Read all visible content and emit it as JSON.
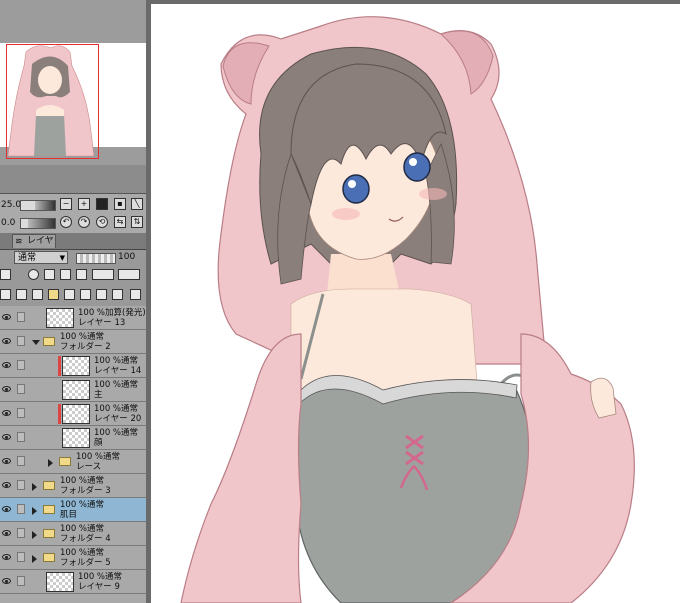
{
  "navigator": {
    "zoom_value": "25.0",
    "rotate_value": "0.0"
  },
  "layer_panel": {
    "tab_label": "レイヤー",
    "blend_mode": "通常",
    "opacity": "100"
  },
  "layers": [
    {
      "mode": "100 %加算(発光)",
      "name": "レイヤー 13",
      "kind": "layer",
      "indent": 0
    },
    {
      "mode": "100 %通常",
      "name": "フォルダー 2",
      "kind": "folder-open",
      "indent": 0
    },
    {
      "mode": "100 %通常",
      "name": "レイヤー 14",
      "kind": "layer-red",
      "indent": 1
    },
    {
      "mode": "100 %通常",
      "name": "主",
      "kind": "layer",
      "indent": 1
    },
    {
      "mode": "100 %通常",
      "name": "レイヤー 20",
      "kind": "layer-red",
      "indent": 1
    },
    {
      "mode": "100 %通常",
      "name": "顔",
      "kind": "layer",
      "indent": 1
    },
    {
      "mode": "100 %通常",
      "name": "レース",
      "kind": "folder",
      "indent": 1
    },
    {
      "mode": "100 %通常",
      "name": "フォルダー 3",
      "kind": "folder",
      "indent": 0
    },
    {
      "mode": "100 %通常",
      "name": "肌目",
      "kind": "folder-selected",
      "indent": 0
    },
    {
      "mode": "100 %通常",
      "name": "フォルダー 4",
      "kind": "folder",
      "indent": 0
    },
    {
      "mode": "100 %通常",
      "name": "フォルダー 5",
      "kind": "folder",
      "indent": 0
    },
    {
      "mode": "100 %通常",
      "name": "レイヤー 9",
      "kind": "layer",
      "indent": 0
    }
  ],
  "colors": {
    "hoodie": "#f0c6cb",
    "hoodie_shadow": "#e3aeb5",
    "hair": "#8b7f7b",
    "skin": "#fde9dc",
    "camisole": "#9ea29f",
    "ribbon": "#d2688e",
    "eyes": "#4a6fb5",
    "selection": "#8fb6d2"
  }
}
